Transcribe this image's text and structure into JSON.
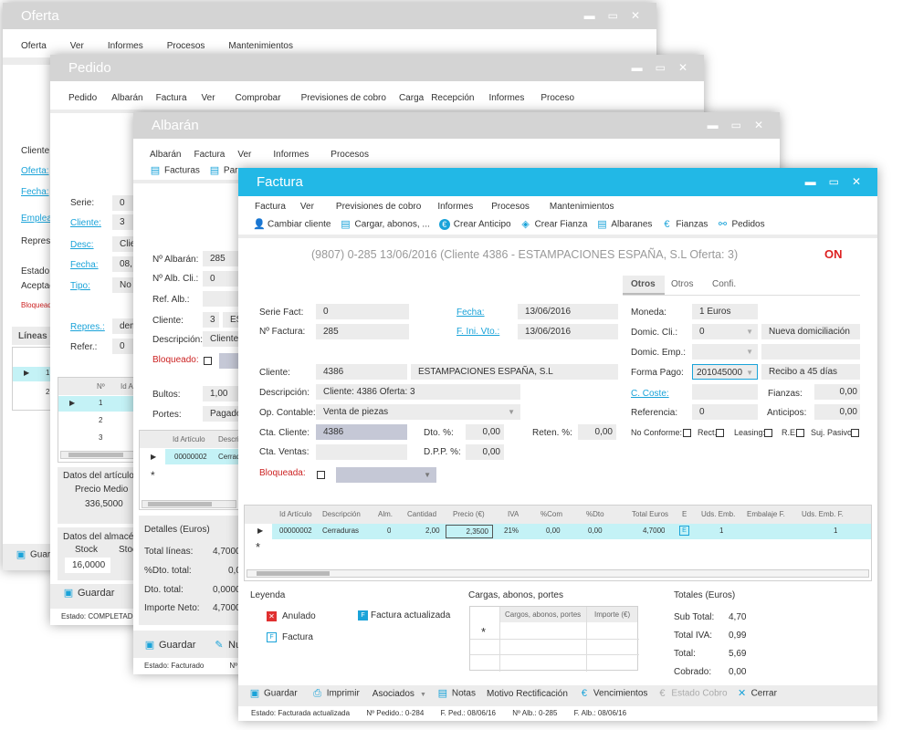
{
  "oferta": {
    "title": "Oferta",
    "menu": [
      "Oferta",
      "Ver",
      "Informes",
      "Procesos",
      "Mantenimientos"
    ],
    "cliente_label": "Cliente:",
    "oferta_link": "Oferta:",
    "fecha_link": "Fecha:",
    "empleado_link": "Emplea",
    "repres_label": "Repres.:",
    "estado_label": "Estado:",
    "aceptado_label": "Aceptac",
    "bloqueado_label": "Bloqueado:",
    "lineas_label": "Líneas d",
    "guardar": "Guar",
    "status": ""
  },
  "pedido": {
    "title": "Pedido",
    "menu": [
      "Pedido",
      "Albarán",
      "Factura",
      "Ver",
      "Comprobar",
      "Previsiones de cobro",
      "Carga",
      "Recepción",
      "Informes",
      "Proceso"
    ],
    "serie_label": "Serie:",
    "serie_value": "0",
    "cliente_link": "Cliente:",
    "cliente_value": "3",
    "desc_link": "Desc:",
    "desc_value": "Clie",
    "fecha_link": "Fecha:",
    "fecha_value": "08,",
    "tipo_link": "Tipo:",
    "tipo_value": "No",
    "repres_link": "Repres.:",
    "repres_value": "dem",
    "refer_label": "Refer.:",
    "refer_value": "0",
    "grid_header_no": "Nº",
    "grid_header_id": "Id A",
    "grid_rows": [
      "1",
      "2",
      "3"
    ],
    "oferta_rows": [
      "1",
      "2"
    ],
    "datos_articulo": "Datos del artículo",
    "precio_medio_label": "Precio Medio",
    "precio_medio_value": "336,5000",
    "datos_almacen": "Datos del almacé",
    "stock_label": "Stock",
    "stock2_label": "Stoc",
    "stock_value": "16,0000",
    "guardar": "Guardar",
    "status": "Estado: COMPLETADO"
  },
  "albaran": {
    "title": "Albarán",
    "menu": [
      "Albarán",
      "Factura",
      "Ver",
      "Informes",
      "Procesos"
    ],
    "toolbar": [
      "Facturas",
      "Par"
    ],
    "no_albaran_label": "Nº Albarán:",
    "no_albaran_value": "285",
    "no_alb_cli_label": "Nº Alb. Cli.:",
    "no_alb_cli_value": "0",
    "ref_alb_label": "Ref. Alb.:",
    "cliente_label": "Cliente:",
    "cliente_value": "3",
    "cliente_value2": "ES",
    "descripcion_label": "Descripción:",
    "descripcion_value": "Cliente:",
    "bloqueado_label": "Bloqueado:",
    "bultos_label": "Bultos:",
    "bultos_value": "1,00",
    "portes_label": "Portes:",
    "portes_value": "Pagados",
    "grid_header_id": "Id Artículo",
    "grid_header_desc": "Descrip",
    "grid_row_id": "00000002",
    "grid_row_desc": "Cerradu",
    "detalles_title": "Detalles (Euros)",
    "total_lineas_label": "Total líneas:",
    "total_lineas_value": "4,7000",
    "pct_dto_label": "%Dto. total:",
    "pct_dto_value": "0,0",
    "dto_total_label": "Dto. total:",
    "dto_total_value": "0,0000",
    "importe_neto_label": "Importe Neto:",
    "importe_neto_value": "4,7000",
    "guardar": "Guardar",
    "nu": "Nu",
    "status_estado": "Estado: Facturado",
    "status_no": "Nº Pe"
  },
  "factura": {
    "title": "Factura",
    "accent": "#22b8e6",
    "menu": [
      "Factura",
      "Ver",
      "Previsiones de cobro",
      "Informes",
      "Procesos",
      "Mantenimientos"
    ],
    "toolbar": [
      {
        "label": "Cambiar cliente",
        "icon": "user-icon"
      },
      {
        "label": "Cargar, abonos, ...",
        "icon": "document-list-icon"
      },
      {
        "label": "Crear Anticipo",
        "icon": "euro-circle-icon"
      },
      {
        "label": "Crear Fianza",
        "icon": "stack-icon"
      },
      {
        "label": "Albaranes",
        "icon": "document-icon"
      },
      {
        "label": "Fianzas",
        "icon": "euro-icon"
      },
      {
        "label": "Pedidos",
        "icon": "cart-icon"
      }
    ],
    "header_info": "(9807)  0-285  13/06/2016  (Cliente 4386 - ESTAMPACIONES ESPAÑA, S.L   Oferta: 3)",
    "on_badge": "ON",
    "tabs": [
      "Otros",
      "Otros",
      "Confi."
    ],
    "serie_fact_label": "Serie Fact:",
    "serie_fact_value": "0",
    "no_factura_label": "Nº Factura:",
    "no_factura_value": "285",
    "fecha_link": "Fecha:",
    "fecha_value": "13/06/2016",
    "f_ini_vto_link": "F. Ini. Vto.:",
    "f_ini_vto_value": "13/06/2016",
    "cliente_label": "Cliente:",
    "cliente_code": "4386",
    "cliente_name": "ESTAMPACIONES ESPAÑA, S.L",
    "descripcion_label": "Descripción:",
    "descripcion_value": "Cliente: 4386  Oferta: 3",
    "op_contable_label": "Op. Contable:",
    "op_contable_value": "Venta de piezas",
    "cta_cliente_label": "Cta. Cliente:",
    "cta_cliente_value": "4386",
    "cta_ventas_label": "Cta. Ventas:",
    "dto_pct_label": "Dto. %:",
    "dto_pct_value": "0,00",
    "dpp_pct_label": "D.P.P. %:",
    "dpp_pct_value": "0,00",
    "reten_label": "Reten. %:",
    "reten_value": "0,00",
    "bloqueada_label": "Bloqueada:",
    "moneda_label": "Moneda:",
    "moneda_value": "1  Euros",
    "domic_cli_label": "Domic. Cli.:",
    "domic_cli_value": "0",
    "nueva_domic": "Nueva domiciliación",
    "domic_emp_label": "Domic. Emp.:",
    "forma_pago_label": "Forma Pago:",
    "forma_pago_value": "201045000",
    "forma_pago_desc": "Recibo a 45 días",
    "c_coste_link": "C. Coste:",
    "fianzas_label": "Fianzas:",
    "fianzas_value": "0,00",
    "referencia_label": "Referencia:",
    "referencia_value": "0",
    "anticipos_label": "Anticipos:",
    "anticipos_value": "0,00",
    "no_conforme_label": "No Conforme:",
    "rect_label": "Rect.",
    "leasing_label": "Leasing:",
    "re_label": "R.E.",
    "suj_pasivo_label": "Suj. Pasivo:",
    "grid_headers": [
      "Id Artículo",
      "Descripción",
      "Alm.",
      "Cantidad",
      "Precio (€)",
      "IVA",
      "%Com",
      "%Dto",
      "Total Euros",
      "E",
      "Uds. Emb.",
      "Embalaje F.",
      "Uds. Emb. F."
    ],
    "grid_row": [
      "00000002",
      "Cerraduras",
      "0",
      "2,00",
      "2,3500",
      "21%",
      "0,00",
      "0,00",
      "4,7000",
      "",
      "1",
      "",
      "1"
    ],
    "leyenda_title": "Leyenda",
    "leyenda_anulado": "Anulado",
    "leyenda_factura_act": "Factura actualizada",
    "leyenda_factura": "Factura",
    "cargas_title": "Cargas, abonos, portes",
    "cargas_headers": [
      "Cargos, abonos, portes",
      "Importe (€)"
    ],
    "totales_title": "Totales (Euros)",
    "sub_total_label": "Sub Total:",
    "sub_total_value": "4,70",
    "total_iva_label": "Total IVA:",
    "total_iva_value": "0,99",
    "total_label": "Total:",
    "total_value": "5,69",
    "cobrado_label": "Cobrado:",
    "cobrado_value": "0,00",
    "bottom_toolbar": [
      {
        "label": "Guardar",
        "icon": "save-icon"
      },
      {
        "label": "Imprimir",
        "icon": "printer-icon"
      },
      {
        "label": "Asociados",
        "icon": "dropdown-icon"
      },
      {
        "label": "Notas",
        "icon": "notes-icon"
      },
      {
        "label": "Motivo Rectificación",
        "icon": ""
      },
      {
        "label": "Vencimientos",
        "icon": "euro-icon"
      },
      {
        "label": "Estado Cobro",
        "icon": "euro-icon"
      },
      {
        "label": "Cerrar",
        "icon": "close-icon"
      }
    ],
    "status": [
      "Estado:  Facturada actualizada",
      "Nº Pedido.: 0-284",
      "F. Ped.: 08/06/16",
      "Nº Alb.: 0-285",
      "F. Alb.: 08/06/16"
    ]
  }
}
